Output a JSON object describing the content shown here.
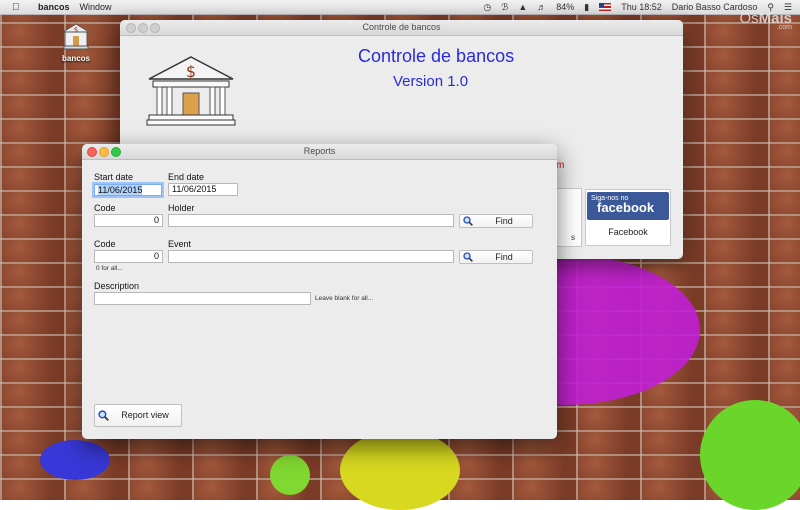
{
  "menubar": {
    "app": "bancos",
    "menus": [
      "Window"
    ],
    "battery": "84%",
    "clock": "Thu 18:52",
    "user": "Dario Basso Cardoso"
  },
  "desktop": {
    "icon_label": "bancos",
    "watermark_a": "Os",
    "watermark_b": "Mais",
    "watermark_c": ".com"
  },
  "main_window": {
    "title": "Controle de bancos",
    "heading": "Controle de bancos",
    "version": "Version 1.0",
    "red_fragment": "m",
    "card_fragment": "s",
    "facebook_badge_small": "Siga-nos no",
    "facebook_badge_big": "facebook",
    "facebook_label": "Facebook"
  },
  "reports": {
    "title": "Reports",
    "start_date_label": "Start date",
    "start_date": "11/06/2015",
    "end_date_label": "End date",
    "end_date": "11/06/2015",
    "code_label_1": "Code",
    "code_1": "0",
    "holder_label": "Holder",
    "holder": "",
    "find_1": "Find",
    "code_label_2": "Code",
    "code_2": "0",
    "code_hint": "0 for all...",
    "event_label": "Event",
    "event": "",
    "find_2": "Find",
    "description_label": "Description",
    "description": "",
    "description_hint": "Leave blank for all...",
    "report_view": "Report view"
  },
  "colors": {
    "heading_blue": "#2a2ad9",
    "facebook_blue": "#3b5998",
    "focus_ring": "#9ec3f7"
  }
}
